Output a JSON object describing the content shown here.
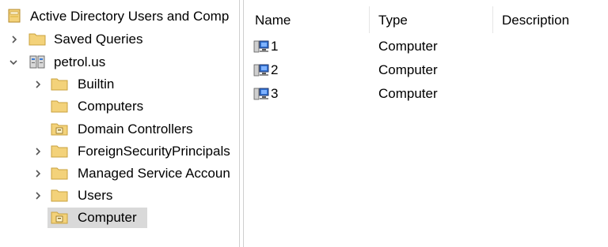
{
  "tree": {
    "root_label": "Active Directory Users and Comp",
    "saved_queries": "Saved Queries",
    "domain": "petrol.us",
    "children": {
      "builtin": "Builtin",
      "computers": "Computers",
      "domain_controllers": "Domain Controllers",
      "foreign": "ForeignSecurityPrincipals",
      "managed": "Managed Service Accoun",
      "users": "Users",
      "computer_ou": "Computer"
    }
  },
  "list": {
    "columns": {
      "name": "Name",
      "type": "Type",
      "description": "Description"
    },
    "rows": [
      {
        "name": "1",
        "type": "Computer"
      },
      {
        "name": "2",
        "type": "Computer"
      },
      {
        "name": "3",
        "type": "Computer"
      }
    ]
  },
  "icons": {
    "root": "console-root-icon",
    "folder": "folder-icon",
    "ou": "organizational-unit-icon",
    "domain": "domain-icon",
    "computer": "computer-icon",
    "chevron_right": "chevron-right-icon",
    "chevron_down": "chevron-down-icon"
  },
  "colors": {
    "folder_fill": "#f3d27a",
    "folder_edge": "#c9a23e",
    "selection": "#d9d9d9",
    "splitter": "#cfcfcf"
  }
}
